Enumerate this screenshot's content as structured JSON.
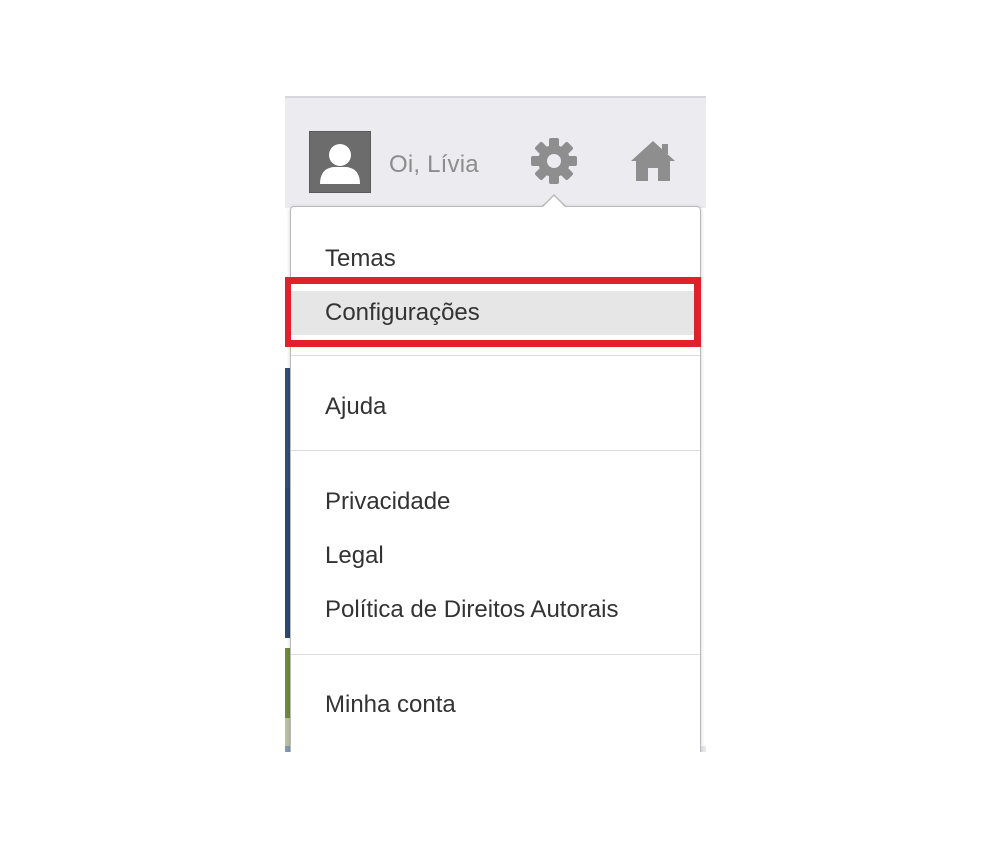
{
  "header": {
    "greeting": "Oi, Lívia",
    "avatar_icon": "user-silhouette-icon",
    "settings_icon": "gear-icon",
    "home_icon": "home-icon"
  },
  "menu": {
    "groups": [
      {
        "items": [
          {
            "label": "Temas"
          },
          {
            "label": "Configurações",
            "highlighted": true
          }
        ]
      },
      {
        "items": [
          {
            "label": "Ajuda"
          }
        ]
      },
      {
        "items": [
          {
            "label": "Privacidade"
          },
          {
            "label": "Legal"
          },
          {
            "label": "Política de Direitos Autorais"
          }
        ]
      },
      {
        "items": [
          {
            "label": "Minha conta"
          }
        ]
      }
    ]
  },
  "colors": {
    "highlight_border": "#e0202a",
    "top_bar": "#ebebf0",
    "icon_gray": "#8e8e8e"
  }
}
